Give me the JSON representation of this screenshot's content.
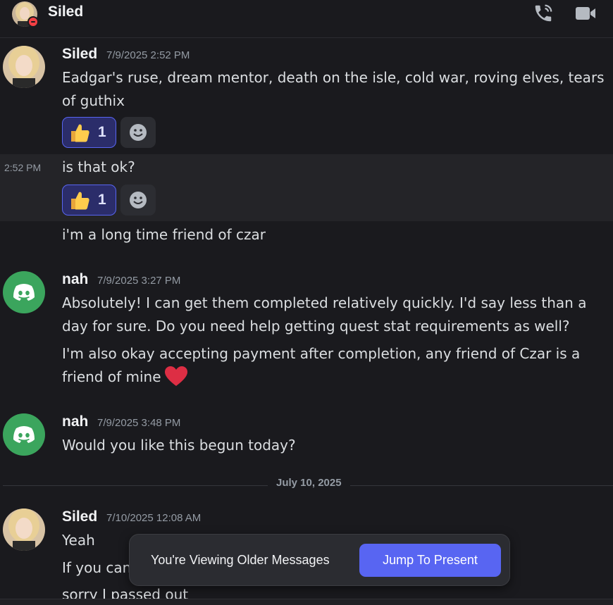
{
  "header": {
    "title": "Siled",
    "call_icon": "phone-call-icon",
    "video_icon": "video-camera-icon",
    "status": "do-not-disturb"
  },
  "messages": [
    {
      "author": "Siled",
      "timestamp": "7/9/2025 2:52 PM",
      "avatar": "photo-avatar",
      "text": "Eadgar's ruse, dream mentor, death on the isle, cold war, roving elves, tears of guthix",
      "reaction": {
        "emoji": "thumbs-up-icon",
        "count": "1"
      }
    },
    {
      "compact_time": "2:52 PM",
      "text": "is that ok?",
      "reaction": {
        "emoji": "thumbs-up-icon",
        "count": "1"
      }
    },
    {
      "text": "i'm a long time friend of czar"
    },
    {
      "author": "nah",
      "timestamp": "7/9/2025 3:27 PM",
      "avatar": "discord-logo-icon",
      "text": "Absolutely! I can get them completed relatively quickly. I'd say less than a day for sure. Do you need help getting quest stat requirements as well?",
      "text2": "I'm also okay accepting payment after completion, any friend of Czar is a friend of mine"
    },
    {
      "author": "nah",
      "timestamp": "7/9/2025 3:48 PM",
      "avatar": "discord-logo-icon",
      "text": "Would you like this begun today?"
    },
    {
      "author": "Siled",
      "timestamp": "7/10/2025 12:08 AM",
      "avatar": "photo-avatar",
      "text": "Yeah",
      "text2": "If you can",
      "text3": "sorry I passed out"
    }
  ],
  "date_divider": "July 10, 2025",
  "older_banner": {
    "label": "You're Viewing Older Messages",
    "button": "Jump To Present"
  },
  "colors": {
    "background": "#1a1a1e",
    "accent": "#5865f2",
    "discord_green": "#3ba55d",
    "dnd_red": "#f23f43"
  }
}
